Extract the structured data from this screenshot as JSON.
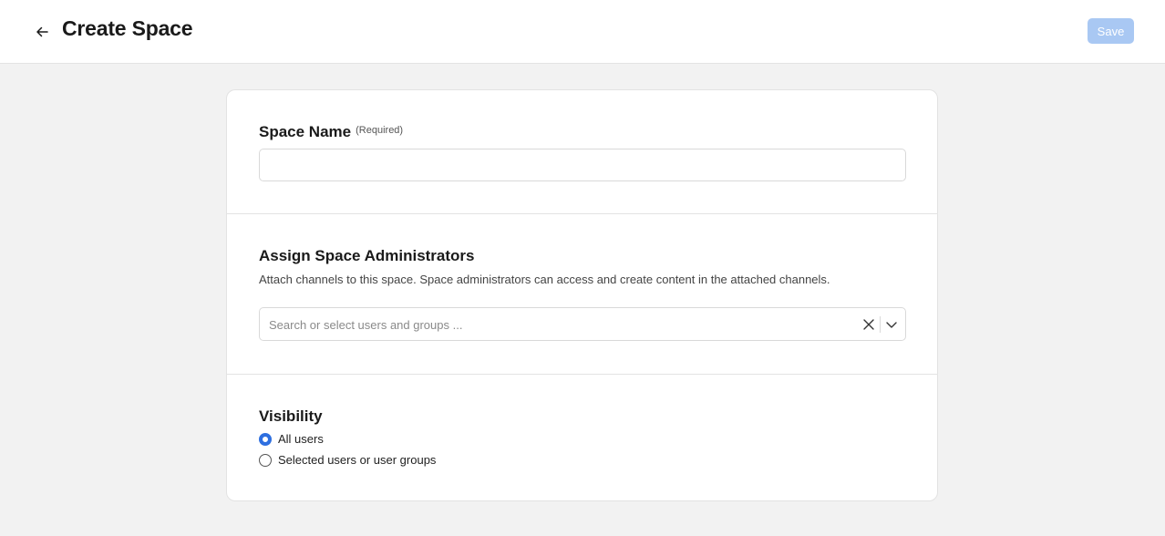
{
  "header": {
    "title": "Create Space",
    "save_label": "Save"
  },
  "space_name": {
    "label": "Space Name",
    "required_hint": "(Required)",
    "value": ""
  },
  "administrators": {
    "label": "Assign Space Administrators",
    "description": "Attach channels to this space. Space administrators can access and create content in the attached channels.",
    "placeholder": "Search or select users and groups ..."
  },
  "visibility": {
    "label": "Visibility",
    "options": [
      {
        "label": "All users",
        "selected": true
      },
      {
        "label": "Selected users or user groups",
        "selected": false
      }
    ]
  },
  "colors": {
    "accent": "#2e6fe0",
    "save_disabled": "#a9c8f3",
    "background": "#f2f2f2"
  },
  "icons": [
    "back-arrow-icon",
    "close-icon",
    "chevron-down-icon"
  ]
}
